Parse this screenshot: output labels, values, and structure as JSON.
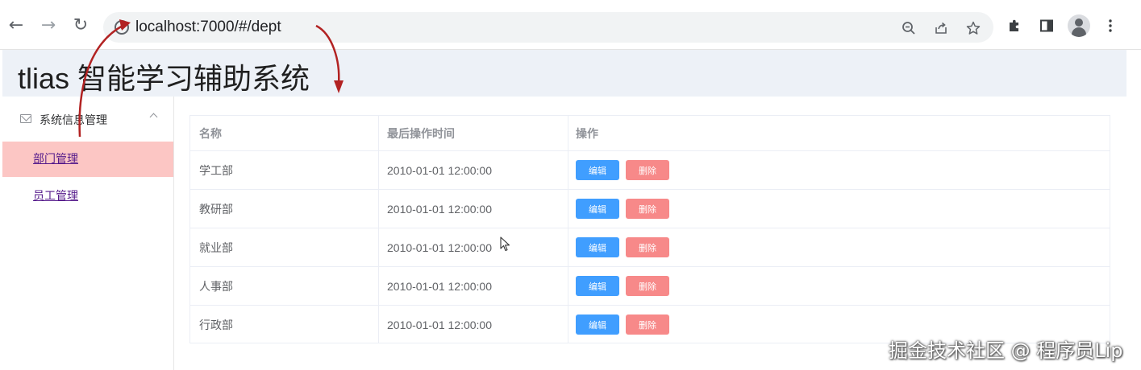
{
  "browser": {
    "url": "localhost:7000/#/dept",
    "nav": {
      "back": "←",
      "forward": "→",
      "reload": "↻"
    }
  },
  "app": {
    "title": "tlias 智能学习辅助系统"
  },
  "sidebar": {
    "group": {
      "label": "系统信息管理",
      "icon": "mail-icon"
    },
    "items": [
      {
        "label": "部门管理",
        "active": true
      },
      {
        "label": "员工管理",
        "active": false
      }
    ]
  },
  "table": {
    "headers": [
      "名称",
      "最后操作时间",
      "操作"
    ],
    "rows": [
      {
        "name": "学工部",
        "time": "2010-01-01 12:00:00"
      },
      {
        "name": "教研部",
        "time": "2010-01-01 12:00:00"
      },
      {
        "name": "就业部",
        "time": "2010-01-01 12:00:00"
      },
      {
        "name": "人事部",
        "time": "2010-01-01 12:00:00"
      },
      {
        "name": "行政部",
        "time": "2010-01-01 12:00:00"
      }
    ],
    "actions": {
      "edit": "编辑",
      "delete": "删除"
    }
  },
  "watermark": "掘金技术社区 @ 程序员Lip",
  "colors": {
    "active_menu_bg": "#fcc6c4",
    "edit_button": "#409eff",
    "delete_button": "#f78989",
    "header_bg": "#edf1f7",
    "annotation_arrow": "#b22222"
  }
}
